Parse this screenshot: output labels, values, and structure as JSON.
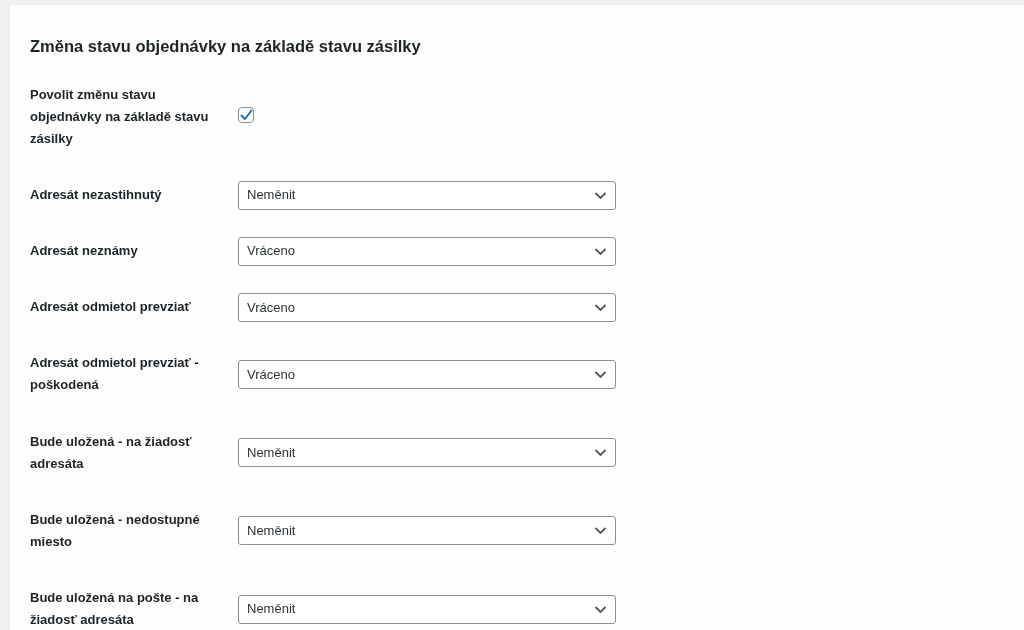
{
  "section_title": "Změna stavu objednávky na základě stavu zásilky",
  "fields": [
    {
      "kind": "checkbox",
      "label": "Povolit změnu stavu objednávky na základě stavu zásilky",
      "checked": true
    },
    {
      "kind": "select",
      "label": "Adresát nezastihnutý",
      "value": "Neměnit"
    },
    {
      "kind": "select",
      "label": "Adresát neznámy",
      "value": "Vráceno"
    },
    {
      "kind": "select",
      "label": "Adresát odmietol prevziať",
      "value": "Vráceno"
    },
    {
      "kind": "select",
      "label": "Adresát odmietol prevziať - poškodená",
      "value": "Vráceno"
    },
    {
      "kind": "select",
      "label": "Bude uložená - na žiadosť adresáta",
      "value": "Neměnit"
    },
    {
      "kind": "select",
      "label": "Bude uložená - nedostupné miesto",
      "value": "Neměnit"
    },
    {
      "kind": "select",
      "label": "Bude uložená na pošte - na žiadosť adresáta",
      "value": "Neměnit"
    }
  ]
}
